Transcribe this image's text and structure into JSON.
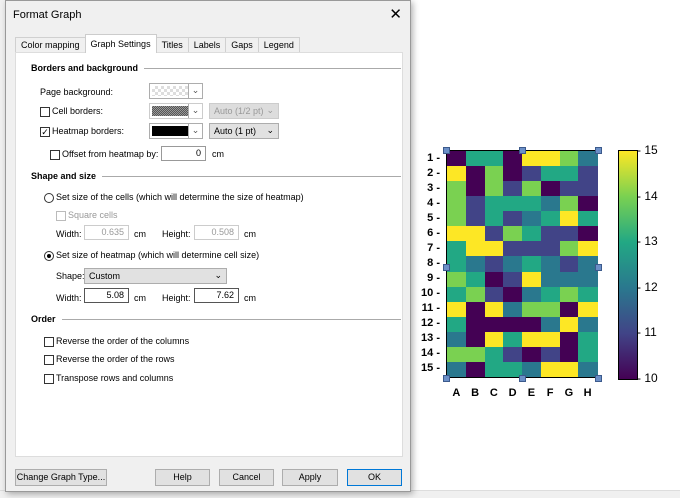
{
  "dialog": {
    "title": "Format Graph",
    "close": "✕",
    "tabs": [
      "Color mapping",
      "Graph Settings",
      "Titles",
      "Labels",
      "Gaps",
      "Legend"
    ],
    "borders": {
      "heading": "Borders and background",
      "page_background": "Page background:",
      "cell_borders": "Cell borders:",
      "cell_borders_width": "Auto (1/2 pt)",
      "heatmap_borders": "Heatmap borders:",
      "heatmap_borders_width": "Auto (1 pt)",
      "offset": "Offset from heatmap by:",
      "offset_value": "0",
      "offset_unit": "cm"
    },
    "shape": {
      "heading": "Shape and size",
      "cells_option": "Set size of the cells (which will determine the size of heatmap)",
      "square": "Square cells",
      "width_label": "Width:",
      "height_label": "Height:",
      "cell_width": "0.635",
      "cell_height": "0.508",
      "unit": "cm",
      "heatmap_option": "Set size of heatmap (which will determine cell size)",
      "shape_label": "Shape:",
      "shape_value": "Custom",
      "hm_width": "5.08",
      "hm_height": "7.62"
    },
    "order": {
      "heading": "Order",
      "rev_cols": "Reverse the order of the columns",
      "rev_rows": "Reverse the order of the rows",
      "transpose": "Transpose rows and columns"
    },
    "buttons": {
      "change": "Change Graph Type...",
      "help": "Help",
      "cancel": "Cancel",
      "apply": "Apply",
      "ok": "OK"
    }
  },
  "chart_data": {
    "type": "heatmap",
    "columns": [
      "A",
      "B",
      "C",
      "D",
      "E",
      "F",
      "G",
      "H"
    ],
    "rows": [
      "1",
      "2",
      "3",
      "4",
      "5",
      "6",
      "7",
      "8",
      "9",
      "10",
      "11",
      "12",
      "13",
      "14",
      "15"
    ],
    "values": [
      [
        10,
        13,
        13,
        10,
        15,
        15,
        14,
        12
      ],
      [
        15,
        10,
        14,
        10,
        11,
        13,
        13,
        11
      ],
      [
        14,
        10,
        14,
        11,
        14,
        10,
        11,
        11
      ],
      [
        14,
        11,
        13,
        13,
        13,
        12,
        14,
        10
      ],
      [
        14,
        11,
        13,
        11,
        12,
        13,
        15,
        13
      ],
      [
        15,
        15,
        11,
        14,
        13,
        11,
        11,
        10
      ],
      [
        13,
        15,
        15,
        11,
        11,
        11,
        14,
        15
      ],
      [
        13,
        12,
        11,
        12,
        13,
        12,
        11,
        12
      ],
      [
        14,
        13,
        10,
        11,
        15,
        12,
        12,
        12
      ],
      [
        13,
        14,
        11,
        10,
        12,
        13,
        14,
        13
      ],
      [
        15,
        10,
        15,
        12,
        14,
        14,
        10,
        15
      ],
      [
        13,
        10,
        10,
        10,
        10,
        12,
        15,
        12
      ],
      [
        12,
        10,
        15,
        13,
        15,
        15,
        10,
        13
      ],
      [
        14,
        14,
        13,
        11,
        10,
        11,
        10,
        13
      ],
      [
        12,
        10,
        13,
        13,
        12,
        15,
        15,
        12
      ]
    ],
    "colorbar": {
      "ticks": [
        "10",
        "11",
        "12",
        "13",
        "14",
        "15"
      ],
      "range": [
        10,
        15
      ]
    },
    "colors": [
      "#440154",
      "#414487",
      "#2a788e",
      "#22a884",
      "#7ad151",
      "#fde725"
    ]
  }
}
